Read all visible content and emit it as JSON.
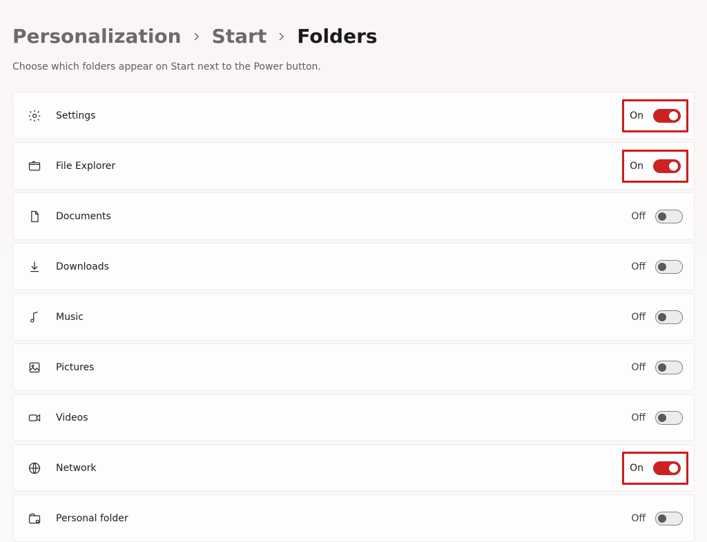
{
  "breadcrumb": {
    "items": [
      "Personalization",
      "Start",
      "Folders"
    ]
  },
  "subtitle": "Choose which folders appear on Start next to the Power button.",
  "state_labels": {
    "on": "On",
    "off": "Off"
  },
  "items": [
    {
      "id": "settings",
      "label": "Settings",
      "on": true,
      "highlight": true,
      "icon": "gear-icon"
    },
    {
      "id": "file-explorer",
      "label": "File Explorer",
      "on": true,
      "highlight": true,
      "icon": "file-explorer-icon"
    },
    {
      "id": "documents",
      "label": "Documents",
      "on": false,
      "highlight": false,
      "icon": "document-icon"
    },
    {
      "id": "downloads",
      "label": "Downloads",
      "on": false,
      "highlight": false,
      "icon": "download-icon"
    },
    {
      "id": "music",
      "label": "Music",
      "on": false,
      "highlight": false,
      "icon": "music-icon"
    },
    {
      "id": "pictures",
      "label": "Pictures",
      "on": false,
      "highlight": false,
      "icon": "picture-icon"
    },
    {
      "id": "videos",
      "label": "Videos",
      "on": false,
      "highlight": false,
      "icon": "video-icon"
    },
    {
      "id": "network",
      "label": "Network",
      "on": true,
      "highlight": true,
      "icon": "network-icon"
    },
    {
      "id": "personal-folder",
      "label": "Personal folder",
      "on": false,
      "highlight": false,
      "icon": "personal-folder-icon"
    }
  ]
}
